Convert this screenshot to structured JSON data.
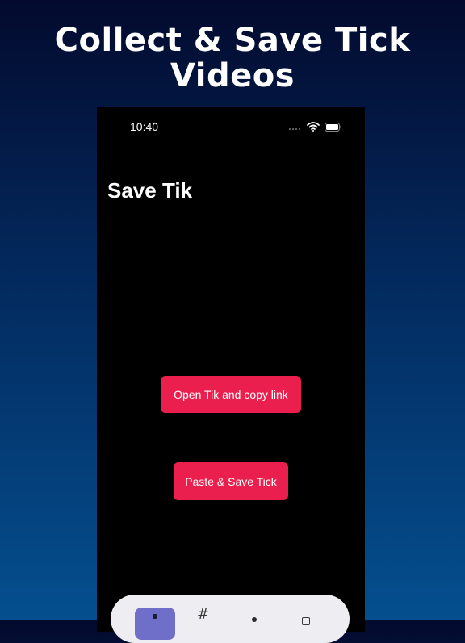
{
  "promo": {
    "headline_line1": "Collect & Save Tick",
    "headline_line2": "Videos"
  },
  "status_bar": {
    "time": "10:40"
  },
  "app": {
    "title": "Save Tik",
    "open_button_label": "Open Tik and copy link",
    "paste_button_label": "Paste & Save Tick"
  },
  "tab_bar": {
    "hash_glyph": "#"
  },
  "colors": {
    "accent": "#ea1f4d",
    "tab_active": "#6f6fc9",
    "phone_bg": "#000000"
  }
}
